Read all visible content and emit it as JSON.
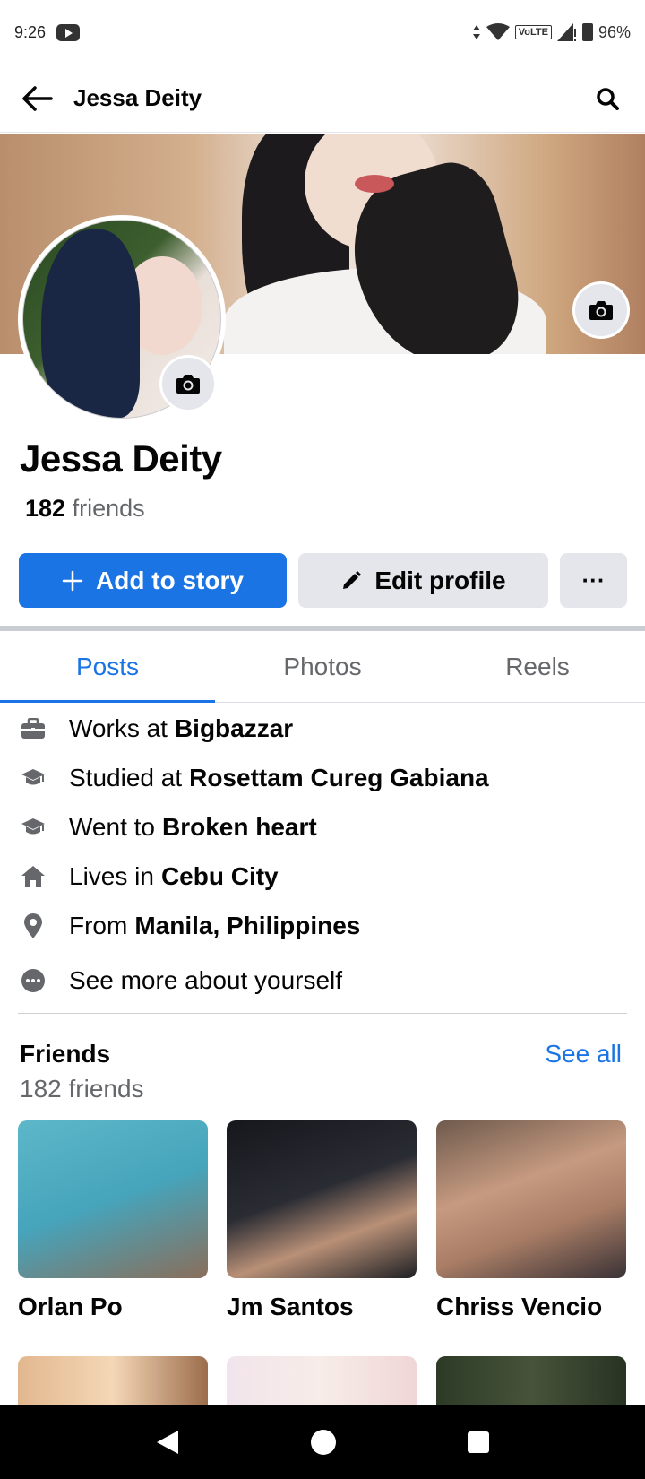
{
  "status_bar": {
    "time": "9:26",
    "network": "VoLTE",
    "battery": "96%"
  },
  "header": {
    "title": "Jessa Deity"
  },
  "profile": {
    "name": "Jessa Deity",
    "friends_count": "182",
    "friends_word": "friends"
  },
  "actions": {
    "add_story": "Add to story",
    "edit_profile": "Edit profile",
    "more": "···"
  },
  "tabs": [
    {
      "label": "Posts",
      "active": true
    },
    {
      "label": "Photos",
      "active": false
    },
    {
      "label": "Reels",
      "active": false
    }
  ],
  "about": [
    {
      "icon": "briefcase-icon",
      "prefix": "Works at",
      "value": "Bigbazzar"
    },
    {
      "icon": "graduation-cap-icon",
      "prefix": "Studied at",
      "value": "Rosettam Cureg Gabiana"
    },
    {
      "icon": "graduation-cap-icon",
      "prefix": "Went to",
      "value": "Broken heart"
    },
    {
      "icon": "home-icon",
      "prefix": "Lives in",
      "value": "Cebu City"
    },
    {
      "icon": "location-pin-icon",
      "prefix": "From",
      "value": "Manila, Philippines"
    }
  ],
  "see_more": "See more about yourself",
  "friends": {
    "title": "Friends",
    "see_all": "See all",
    "subtitle": "182 friends",
    "list": [
      {
        "name": "Orlan Po"
      },
      {
        "name": "Jm Santos"
      },
      {
        "name": "Chriss Vencio"
      }
    ]
  },
  "colors": {
    "accent": "#1b74e4",
    "secondary_text": "#65676b",
    "button_gray": "#e4e6eb"
  }
}
